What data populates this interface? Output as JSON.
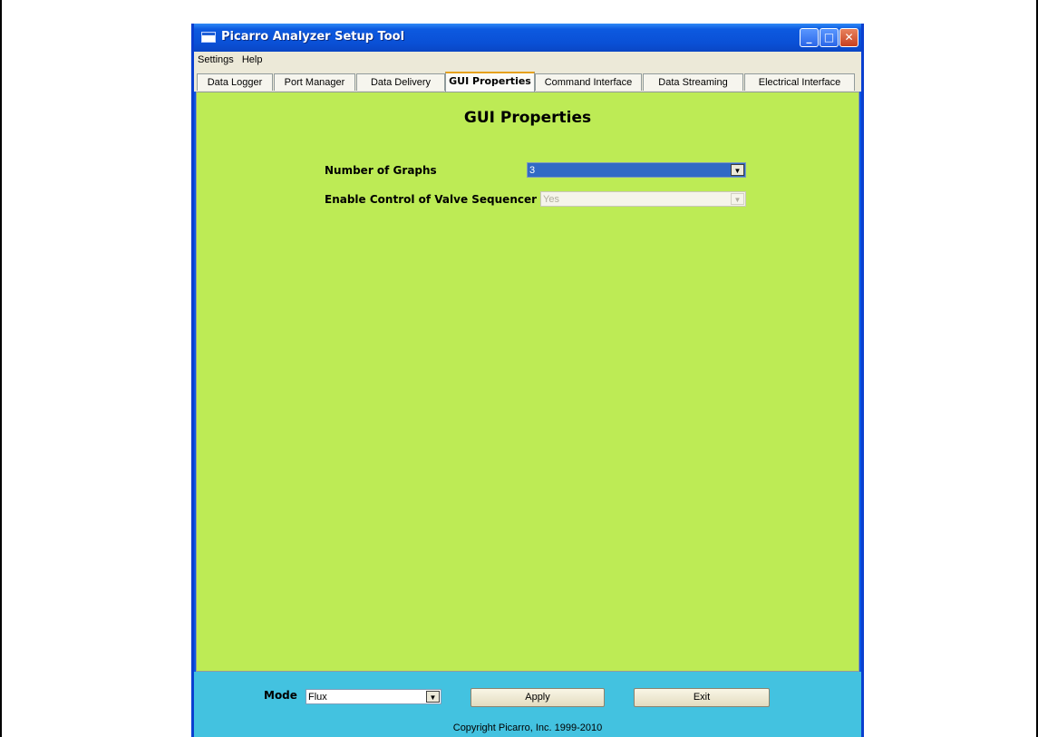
{
  "window": {
    "title": "Picarro Analyzer Setup Tool",
    "controls": {
      "minimize": "_",
      "maximize": "□",
      "close": "✕"
    }
  },
  "menu": {
    "items": [
      "Settings",
      "Help"
    ]
  },
  "tabs": [
    {
      "label": "Data Logger",
      "active": false
    },
    {
      "label": "Port Manager",
      "active": false
    },
    {
      "label": "Data Delivery",
      "active": false
    },
    {
      "label": "GUI Properties",
      "active": true
    },
    {
      "label": "Command Interface",
      "active": false
    },
    {
      "label": "Data Streaming",
      "active": false
    },
    {
      "label": "Electrical Interface",
      "active": false
    }
  ],
  "panel": {
    "title": "GUI Properties",
    "fields": [
      {
        "label": "Number of Graphs",
        "value": "3",
        "state": "selected"
      },
      {
        "label": "Enable Control of Valve Sequencer",
        "value": "Yes",
        "state": "disabled"
      }
    ]
  },
  "footer": {
    "mode_label": "Mode",
    "mode_value": "Flux",
    "apply_label": "Apply",
    "exit_label": "Exit",
    "copyright": "Copyright Picarro, Inc. 1999-2010"
  },
  "icons": {
    "dropdown_arrow": "chevron-down-icon",
    "app": "window-app-icon"
  },
  "colors": {
    "panel_bg": "#bdeb55",
    "footer_bg": "#43c2e0",
    "titlebar": "#0a56e4",
    "selection": "#316ac5",
    "active_tab_accent": "#e6a11c"
  }
}
